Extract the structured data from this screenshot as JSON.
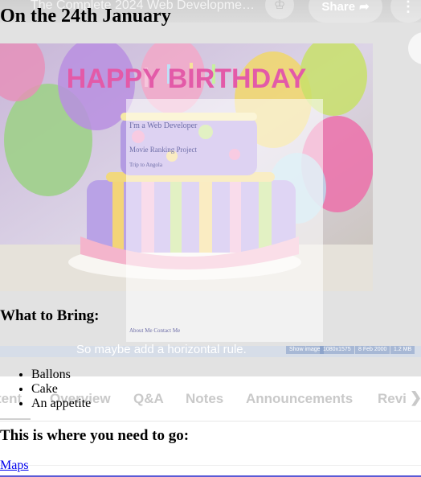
{
  "player": {
    "video_title": "The Complete 2024 Web Developme…",
    "share_label": "Share",
    "subtitle": "So maybe add a horizontal rule.",
    "status_items": [
      "Show image",
      "1080x1575",
      "8 Feb 2000",
      "1.2 MB"
    ],
    "tabs": [
      {
        "label": "tent"
      },
      {
        "label": "Overview"
      },
      {
        "label": "Q&A"
      },
      {
        "label": "Notes"
      },
      {
        "label": "Announcements"
      },
      {
        "label": "Revi"
      }
    ],
    "ghost_links": [
      "I'm a Web Developer",
      "Movie Ranking Project",
      "Trip to Angola",
      "About Me  Contact Me"
    ]
  },
  "document": {
    "event_date": "On the 24th January",
    "image_text": "HAPPY BIRTHDAY",
    "bring_heading": "What to Bring:",
    "bring_items": [
      "Ballons",
      "Cake",
      "An appetite"
    ],
    "go_heading": "This is where you need to go:",
    "maps_link": "Maps"
  },
  "colors": {
    "link": "#0000ee",
    "accent": "#5b5bd6"
  }
}
